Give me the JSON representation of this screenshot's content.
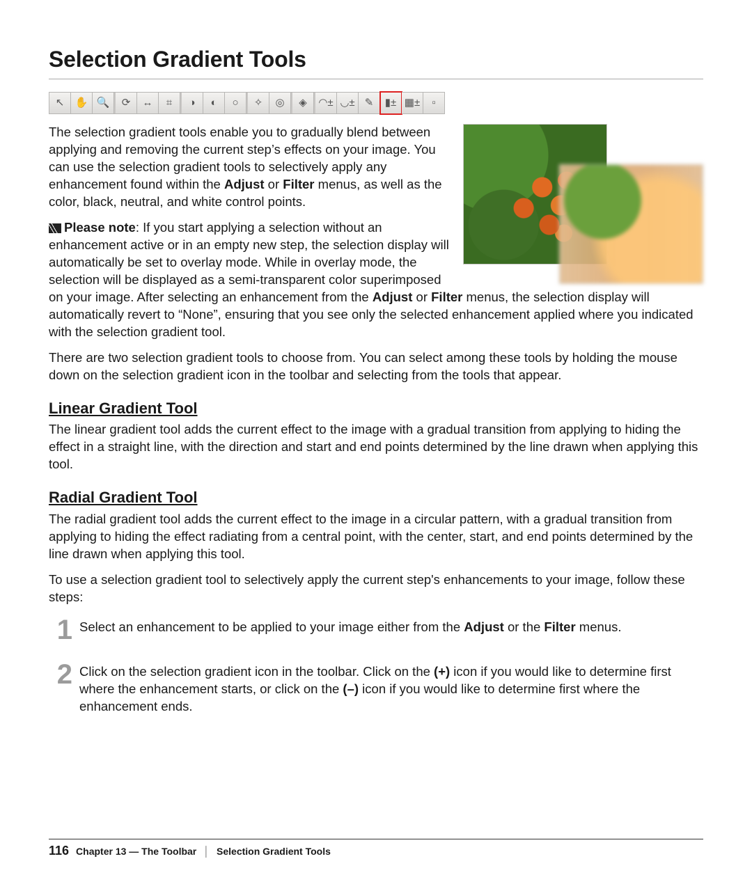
{
  "heading": "Selection Gradient Tools",
  "toolbar_icons": [
    {
      "name": "pointer-icon",
      "glyph": "↖"
    },
    {
      "name": "hand-icon",
      "glyph": "✋"
    },
    {
      "name": "magnifier-icon",
      "glyph": "🔍"
    },
    {
      "name": "rotate-icon",
      "glyph": "⟳",
      "sep_before": true
    },
    {
      "name": "straighten-icon",
      "glyph": "↔"
    },
    {
      "name": "crop-icon",
      "glyph": "⌗"
    },
    {
      "name": "black-point-icon",
      "glyph": "◑",
      "sep_before": true
    },
    {
      "name": "neutral-point-icon",
      "glyph": "◐"
    },
    {
      "name": "white-point-icon",
      "glyph": "○"
    },
    {
      "name": "auto-retouch-icon",
      "glyph": "✧",
      "sep_before": true
    },
    {
      "name": "redeye-icon",
      "glyph": "◎"
    },
    {
      "name": "color-picker-icon",
      "glyph": "◈",
      "sep_before": true
    },
    {
      "name": "lasso-plus-icon",
      "glyph": "◠±",
      "sep_before": true
    },
    {
      "name": "lasso-minus-icon",
      "glyph": "◡±"
    },
    {
      "name": "brush-icon",
      "glyph": "✎"
    },
    {
      "name": "linear-gradient-icon",
      "glyph": "▮±",
      "selected": true
    },
    {
      "name": "radial-gradient-icon",
      "glyph": "▦±"
    },
    {
      "name": "overflow-icon",
      "glyph": "▫"
    }
  ],
  "intro": {
    "p1a": "The selection gradient tools enable you to gradually blend between applying and removing the current step’s effects on your image. You can use the selection gradient tools to selectively apply any enhancement found within the ",
    "p1b_bold": "Adjust",
    "p1c": " or ",
    "p1d_bold": "Filter",
    "p1e": " menus, as well as the color, black, neutral, and white control points.",
    "note_label": "Please note",
    "note_a": ": If you start applying a selection without an enhancement active or in an empty new step, the selection display will automatically be set to overlay mode. While in overlay mode, the selection will be displayed as a semi-transparent color superimposed on your image. After selecting an enhancement from the ",
    "note_b_bold": "Adjust",
    "note_c": " or ",
    "note_d_bold": "Filter",
    "note_e": " menus, the selection display will automatically revert to “None”, ensuring that you see only the selected enhancement applied where you indicated with the selection gradient tool.",
    "p3": "There are two selection gradient tools to choose from. You can select among these tools by holding the mouse down on the selection gradient icon in the toolbar and selecting from the tools that appear."
  },
  "linear": {
    "heading": "Linear Gradient Tool",
    "body": "The linear gradient tool adds the current effect to the image with a gradual transition from applying to hiding the effect in a straight line, with the direction and start and end points determined by the line drawn when applying this tool."
  },
  "radial": {
    "heading": "Radial Gradient Tool",
    "body": "The radial gradient tool adds the current effect to the image in a circular pattern, with a gradual transition from applying to hiding the effect radiating from a central point, with the center, start, and end points determined by the line drawn when applying this tool.",
    "howto": "To use a selection gradient tool to selectively apply the current step's enhancements to your image, follow these steps:"
  },
  "steps": {
    "s1_num": "1",
    "s1a": "Select an enhancement to be applied to your image either from the ",
    "s1b_bold": "Adjust",
    "s1c": " or the ",
    "s1d_bold": "Filter",
    "s1e": " menus.",
    "s2_num": "2",
    "s2a": "Click on the selection gradient icon in the toolbar. Click on the ",
    "s2b_bold": "(+)",
    "s2c": " icon if you would like to determine first where the enhancement starts, or click on the ",
    "s2d_bold": "(–)",
    "s2e": " icon if you would like to determine first where the enhancement ends."
  },
  "footer": {
    "page": "116",
    "chapter": "Chapter 13 — The Toolbar",
    "section": "Selection Gradient Tools"
  }
}
